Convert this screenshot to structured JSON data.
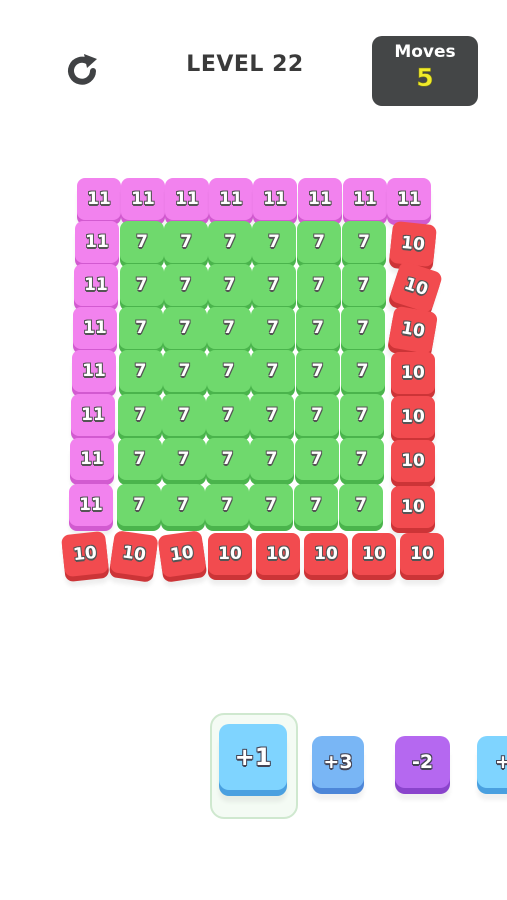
{
  "header": {
    "restart_icon": "restart-icon",
    "level_title": "LEVEL 22",
    "moves_label": "Moves",
    "moves_value": "5"
  },
  "colors": {
    "pink": "#f282ee",
    "green": "#6fd96d",
    "red": "#f24b4f",
    "moves_panel": "#444647",
    "moves_value": "#f0ea2a"
  },
  "board": {
    "rows": [
      [
        "11",
        "11",
        "11",
        "11",
        "11",
        "11",
        "11",
        "11"
      ],
      [
        "11",
        "7",
        "7",
        "7",
        "7",
        "7",
        "7",
        "10"
      ],
      [
        "11",
        "7",
        "7",
        "7",
        "7",
        "7",
        "7",
        "10"
      ],
      [
        "11",
        "7",
        "7",
        "7",
        "7",
        "7",
        "7",
        "10"
      ],
      [
        "11",
        "7",
        "7",
        "7",
        "7",
        "7",
        "7",
        "10"
      ],
      [
        "11",
        "7",
        "7",
        "7",
        "7",
        "7",
        "7",
        "10"
      ],
      [
        "11",
        "7",
        "7",
        "7",
        "7",
        "7",
        "7",
        "10"
      ],
      [
        "11",
        "7",
        "7",
        "7",
        "7",
        "7",
        "7",
        "10"
      ],
      [
        "10",
        "10",
        "10",
        "10",
        "10",
        "10",
        "10",
        "10"
      ]
    ]
  },
  "tray": {
    "pieces": [
      {
        "label": "+1",
        "color": "blue",
        "selected": true
      },
      {
        "label": "+3",
        "color": "blue"
      },
      {
        "label": "-2",
        "color": "purple"
      },
      {
        "label": "+",
        "color": "blue"
      }
    ]
  }
}
